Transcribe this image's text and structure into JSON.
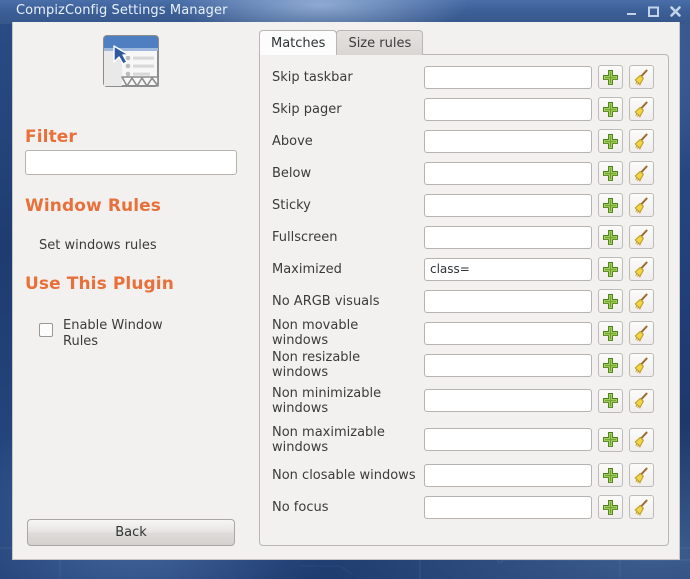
{
  "window": {
    "title": "CompizConfig Settings Manager",
    "controls": [
      {
        "name": "minimize",
        "glyph": "minimize-icon"
      },
      {
        "name": "maximize",
        "glyph": "maximize-icon"
      },
      {
        "name": "close",
        "glyph": "close-icon"
      }
    ]
  },
  "sidebar": {
    "plugin_icon": "window-rules-icon",
    "filter_heading": "Filter",
    "filter_value": "",
    "filter_placeholder": "",
    "window_rules_heading": "Window Rules",
    "window_rules_description": "Set windows rules",
    "use_plugin_heading": "Use This Plugin",
    "enable_checkbox_label": "Enable Window Rules",
    "enable_checkbox_checked": false,
    "back_label": "Back"
  },
  "notebook": {
    "tabs": [
      {
        "label": "Matches",
        "active": true
      },
      {
        "label": "Size rules",
        "active": false
      }
    ],
    "add_icon": "plus-icon",
    "clear_icon": "broom-icon",
    "rows": [
      {
        "label": "Skip taskbar",
        "value": "",
        "tall": false
      },
      {
        "label": "Skip pager",
        "value": "",
        "tall": false
      },
      {
        "label": "Above",
        "value": "",
        "tall": false
      },
      {
        "label": "Below",
        "value": "",
        "tall": false
      },
      {
        "label": "Sticky",
        "value": "",
        "tall": false
      },
      {
        "label": "Fullscreen",
        "value": "",
        "tall": false
      },
      {
        "label": "Maximized",
        "value": "class=",
        "tall": false
      },
      {
        "label": "No ARGB visuals",
        "value": "",
        "tall": false
      },
      {
        "label": "Non movable windows",
        "value": "",
        "tall": false
      },
      {
        "label": "Non resizable windows",
        "value": "",
        "tall": false
      },
      {
        "label": "Non minimizable windows",
        "value": "",
        "tall": true
      },
      {
        "label": "Non maximizable windows",
        "value": "",
        "tall": true
      },
      {
        "label": "Non closable windows",
        "value": "",
        "tall": false
      },
      {
        "label": "No focus",
        "value": "",
        "tall": false
      }
    ]
  },
  "colors": {
    "accent_orange": "#e8703a",
    "titlebar_blue": "#3d6099",
    "panel_gray": "#f2f1f0",
    "plus_green": "#6fa32c",
    "broom_yellow": "#f0d44a"
  }
}
